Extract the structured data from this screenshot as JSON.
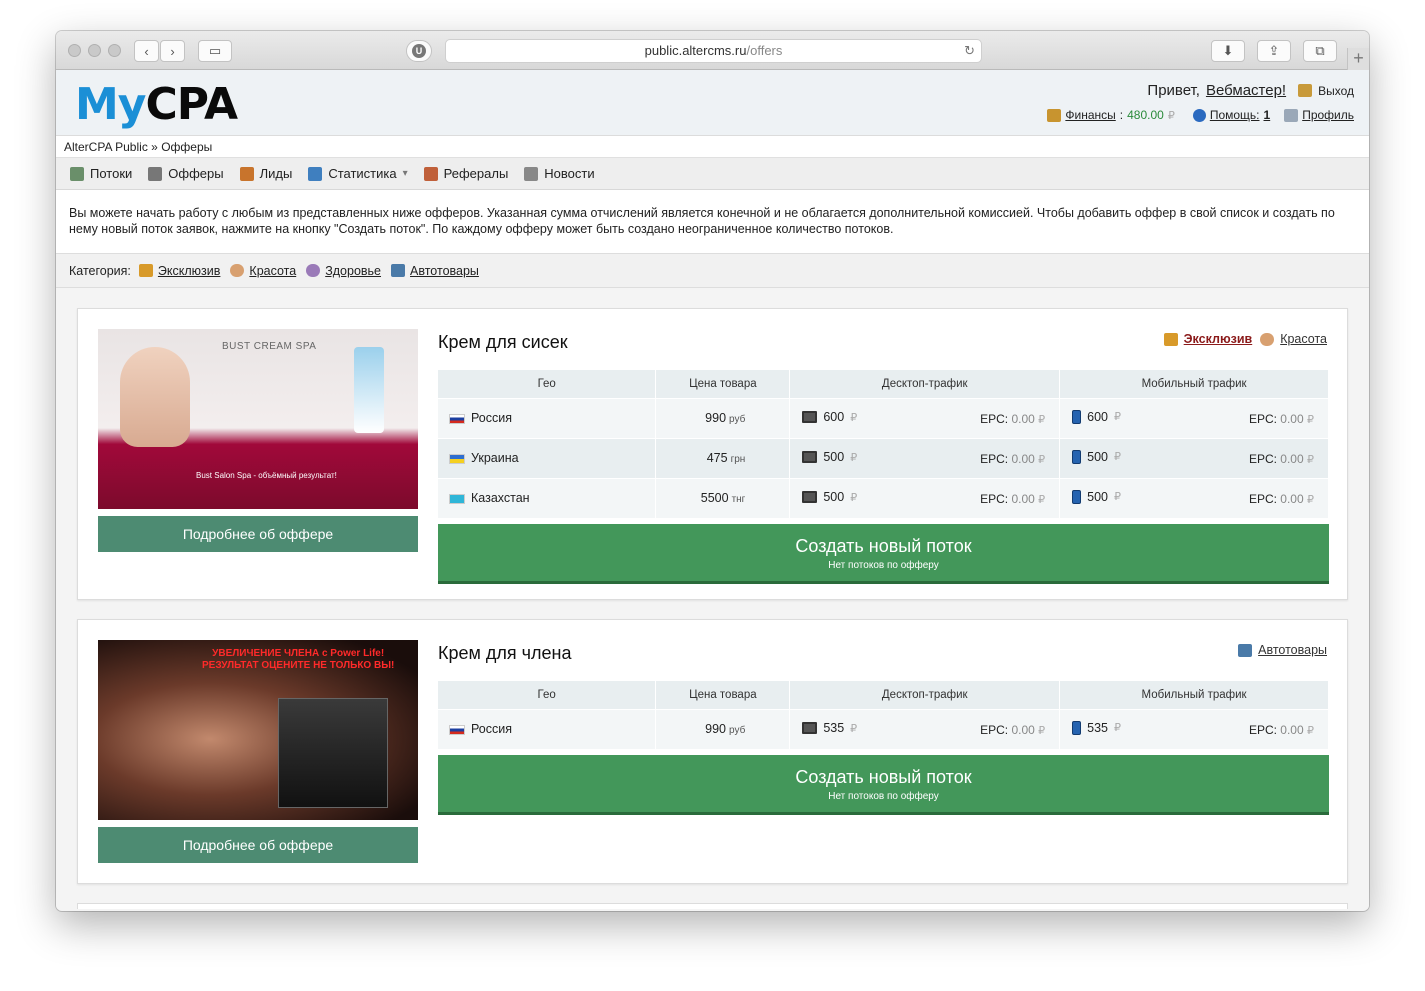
{
  "browser": {
    "url_host": "public.altercms.ru",
    "url_path": "/offers",
    "reader_button": "U"
  },
  "header": {
    "logo_my": "My",
    "logo_cpa": "CPA",
    "greeting": "Привет,",
    "username": "Вебмастер!",
    "logout": "Выход",
    "finance_label": "Финансы",
    "finance_value": "480.00",
    "currency_glyph": "₽",
    "help_label": "Помощь:",
    "help_count": "1",
    "profile_label": "Профиль"
  },
  "breadcrumb": {
    "home": "AlterCPA Public",
    "separator": "»",
    "current": "Офферы"
  },
  "menu": {
    "items": [
      {
        "label": "Потоки",
        "icon": "streams-icon",
        "color": "#6a8f6a"
      },
      {
        "label": "Офферы",
        "icon": "offers-icon",
        "color": "#777777"
      },
      {
        "label": "Лиды",
        "icon": "leads-icon",
        "color": "#c8742c"
      },
      {
        "label": "Статистика",
        "icon": "stats-icon",
        "color": "#3f7fbf",
        "dropdown": "▾"
      },
      {
        "label": "Рефералы",
        "icon": "referrals-icon",
        "color": "#c0603a"
      },
      {
        "label": "Новости",
        "icon": "news-icon",
        "color": "#888888"
      }
    ]
  },
  "info_text": "Вы можете начать работу с любым из представленных ниже офферов. Указанная сумма отчислений является конечной и не облагается дополнительной комиссией. Чтобы добавить оффер в свой список и создать по нему новый поток заявок, нажмите на кнопку \"Создать поток\". По каждому офферу может быть создано неограниченное количество потоков.",
  "categories": {
    "label": "Категория:",
    "items": [
      {
        "label": "Эксклюзив",
        "icon": "crown-icon",
        "color": "#d89a2a"
      },
      {
        "label": "Красота",
        "icon": "flower-icon",
        "color": "#d8a070"
      },
      {
        "label": "Здоровье",
        "icon": "potion-icon",
        "color": "#9a7ab8"
      },
      {
        "label": "Автотовары",
        "icon": "car-icon",
        "color": "#4a7aa8"
      }
    ]
  },
  "table_headers": {
    "geo": "Гео",
    "price": "Цена товара",
    "desktop": "Десктоп-трафик",
    "mobile": "Мобильный трафик",
    "epc_label": "EPC:"
  },
  "buttons": {
    "details": "Подробнее об оффере",
    "create": "Создать новый поток",
    "create_sub": "Нет потоков по офферу"
  },
  "offers": [
    {
      "title": "Крем для сисек",
      "banner_title": "BUST CREAM SPA",
      "banner_caption": "Bust Salon Spa - объёмный результат!",
      "categories": [
        {
          "label": "Эксклюзив",
          "icon": "crown-icon",
          "exclusive": true
        },
        {
          "label": "Красота",
          "icon": "flower-icon",
          "exclusive": false
        }
      ],
      "rows": [
        {
          "country": "Россия",
          "flag": [
            "#ffffff",
            "#1c3fa0",
            "#d52b1e"
          ],
          "price": "990",
          "currency": "руб",
          "desktop": "600",
          "desktop_epc": "0.00",
          "mobile": "600",
          "mobile_epc": "0.00"
        },
        {
          "country": "Украина",
          "flag": [
            "#2f6fd0",
            "#2f6fd0",
            "#f5d020"
          ],
          "price": "475",
          "currency": "грн",
          "desktop": "500",
          "desktop_epc": "0.00",
          "mobile": "500",
          "mobile_epc": "0.00"
        },
        {
          "country": "Казахстан",
          "flag": [
            "#2fb6d8",
            "#2fb6d8",
            "#2fb6d8"
          ],
          "price": "5500",
          "currency": "тнг",
          "desktop": "500",
          "desktop_epc": "0.00",
          "mobile": "500",
          "mobile_epc": "0.00"
        }
      ]
    },
    {
      "title": "Крем для члена",
      "banner_title_line1": "УВЕЛИЧЕНИЕ ЧЛЕНА с Power Life!",
      "banner_title_line2": "РЕЗУЛЬТАТ ОЦЕНИТЕ НЕ ТОЛЬКО ВЫ!",
      "categories": [
        {
          "label": "Автотовары",
          "icon": "car-icon",
          "exclusive": false
        }
      ],
      "rows": [
        {
          "country": "Россия",
          "flag": [
            "#ffffff",
            "#1c3fa0",
            "#d52b1e"
          ],
          "price": "990",
          "currency": "руб",
          "desktop": "535",
          "desktop_epc": "0.00",
          "mobile": "535",
          "mobile_epc": "0.00"
        }
      ]
    }
  ]
}
